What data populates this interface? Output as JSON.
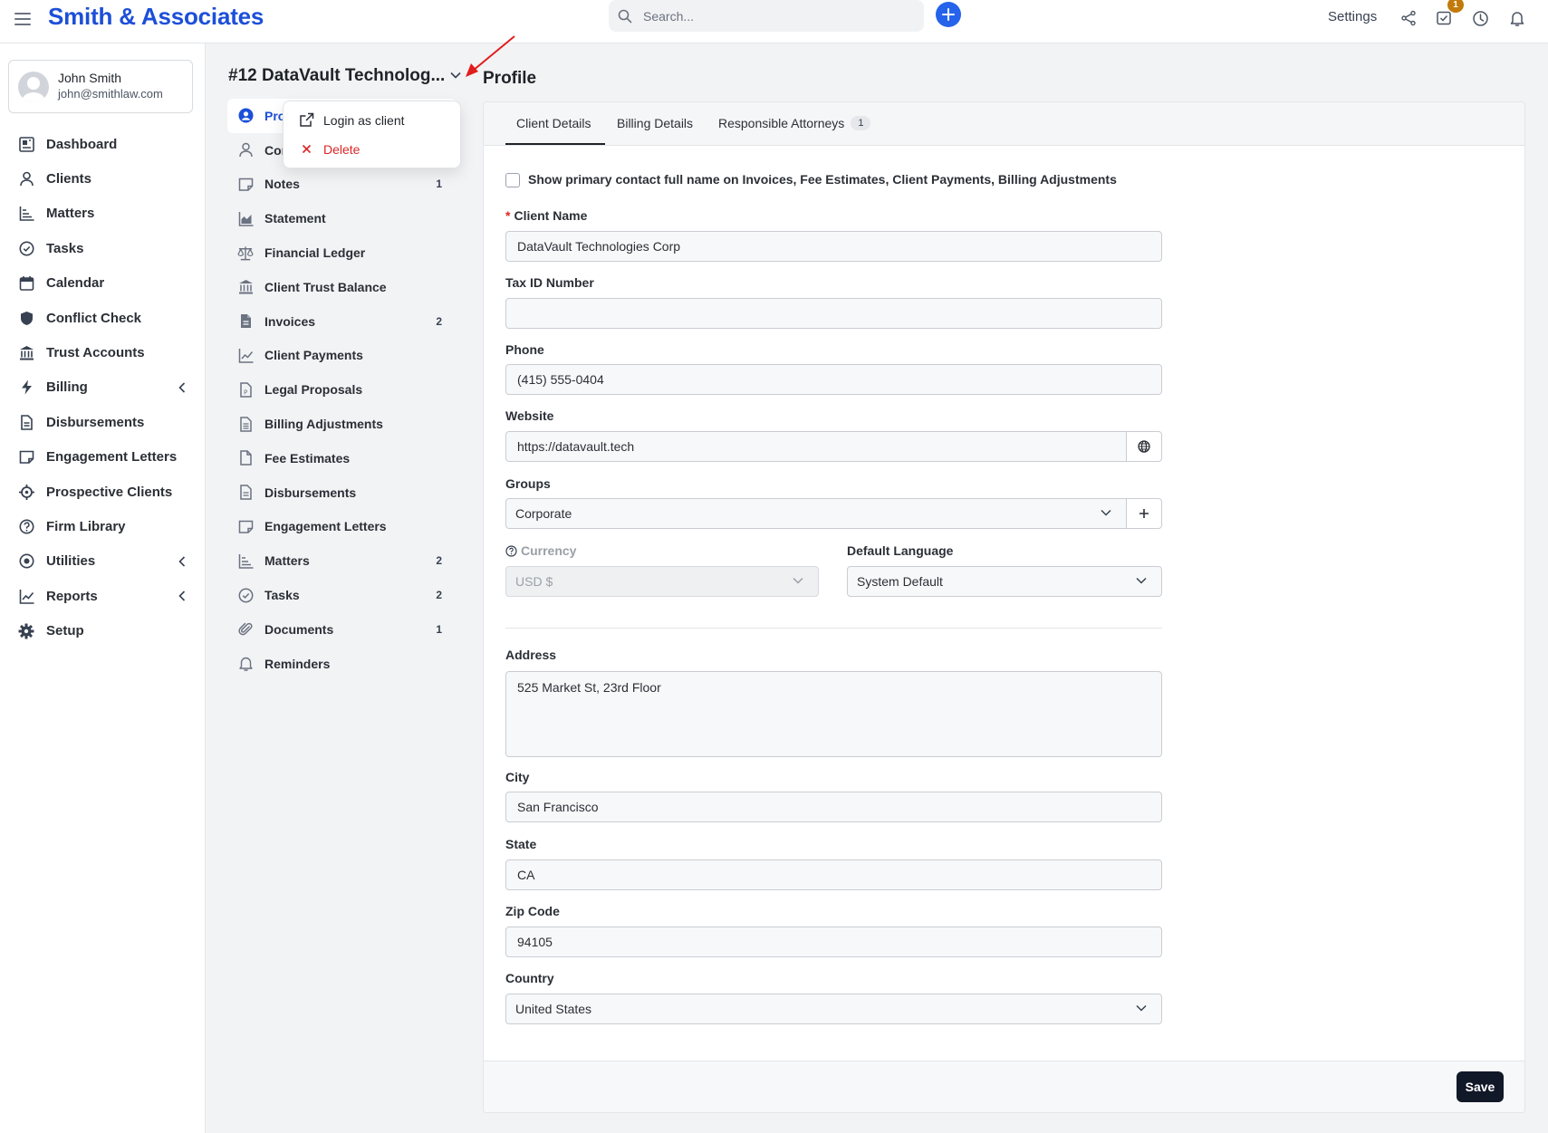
{
  "app": {
    "brand": "Smith & Associates"
  },
  "topbar": {
    "search_placeholder": "Search...",
    "settings_label": "Settings",
    "tasks_badge": "1"
  },
  "user": {
    "name": "John Smith",
    "email": "john@smithlaw.com"
  },
  "sidebar": {
    "items": [
      {
        "label": "Dashboard",
        "icon": "dashboard-icon"
      },
      {
        "label": "Clients",
        "icon": "user-icon"
      },
      {
        "label": "Matters",
        "icon": "matters-icon"
      },
      {
        "label": "Tasks",
        "icon": "check-circle-icon"
      },
      {
        "label": "Calendar",
        "icon": "calendar-icon"
      },
      {
        "label": "Conflict Check",
        "icon": "shield-icon"
      },
      {
        "label": "Trust Accounts",
        "icon": "bank-icon"
      },
      {
        "label": "Billing",
        "icon": "bolt-icon"
      },
      {
        "label": "Disbursements",
        "icon": "document-icon"
      },
      {
        "label": "Engagement Letters",
        "icon": "note-icon"
      },
      {
        "label": "Prospective Clients",
        "icon": "crosshair-icon"
      },
      {
        "label": "Firm Library",
        "icon": "help-icon"
      },
      {
        "label": "Utilities",
        "icon": "target-icon"
      },
      {
        "label": "Reports",
        "icon": "chart-icon"
      },
      {
        "label": "Setup",
        "icon": "gear-icon"
      }
    ]
  },
  "client": {
    "title": "#12 DataVault Technolog..."
  },
  "subnav": {
    "items": [
      {
        "label": "Pro",
        "count": ""
      },
      {
        "label": "Cor",
        "count": ""
      },
      {
        "label": "Notes",
        "count": "1"
      },
      {
        "label": "Statement",
        "count": ""
      },
      {
        "label": "Financial Ledger",
        "count": ""
      },
      {
        "label": "Client Trust Balance",
        "count": ""
      },
      {
        "label": "Invoices",
        "count": "2"
      },
      {
        "label": "Client Payments",
        "count": ""
      },
      {
        "label": "Legal Proposals",
        "count": ""
      },
      {
        "label": "Billing Adjustments",
        "count": ""
      },
      {
        "label": "Fee Estimates",
        "count": ""
      },
      {
        "label": "Disbursements",
        "count": ""
      },
      {
        "label": "Engagement Letters",
        "count": ""
      },
      {
        "label": "Matters",
        "count": "2"
      },
      {
        "label": "Tasks",
        "count": "2"
      },
      {
        "label": "Documents",
        "count": "1"
      },
      {
        "label": "Reminders",
        "count": ""
      }
    ]
  },
  "dropdown": {
    "login_label": "Login as client",
    "delete_label": "Delete"
  },
  "main": {
    "title": "Profile",
    "tabs": [
      {
        "label": "Client Details"
      },
      {
        "label": "Billing Details"
      },
      {
        "label": "Responsible Attorneys",
        "count": "1"
      }
    ],
    "checkbox_label": "Show primary contact full name on Invoices, Fee Estimates, Client Payments, Billing Adjustments",
    "fields": {
      "client_name": {
        "label": "Client Name",
        "value": "DataVault Technologies Corp"
      },
      "tax_id": {
        "label": "Tax ID Number",
        "value": ""
      },
      "phone": {
        "label": "Phone",
        "value": "(415) 555-0404"
      },
      "website": {
        "label": "Website",
        "value": "https://datavault.tech"
      },
      "groups": {
        "label": "Groups",
        "value": "Corporate"
      },
      "currency": {
        "label": "Currency",
        "value": "USD $"
      },
      "language": {
        "label": "Default Language",
        "value": "System Default"
      },
      "address": {
        "label": "Address",
        "value": "525 Market St, 23rd Floor"
      },
      "city": {
        "label": "City",
        "value": "San Francisco"
      },
      "state": {
        "label": "State",
        "value": "CA"
      },
      "zip": {
        "label": "Zip Code",
        "value": "94105"
      },
      "country": {
        "label": "Country",
        "value": "United States"
      }
    },
    "save_label": "Save"
  },
  "colors": {
    "brand": "#1d4fd8",
    "accent": "#2563eb",
    "danger": "#dc2626",
    "badge": "#c27a0a"
  }
}
